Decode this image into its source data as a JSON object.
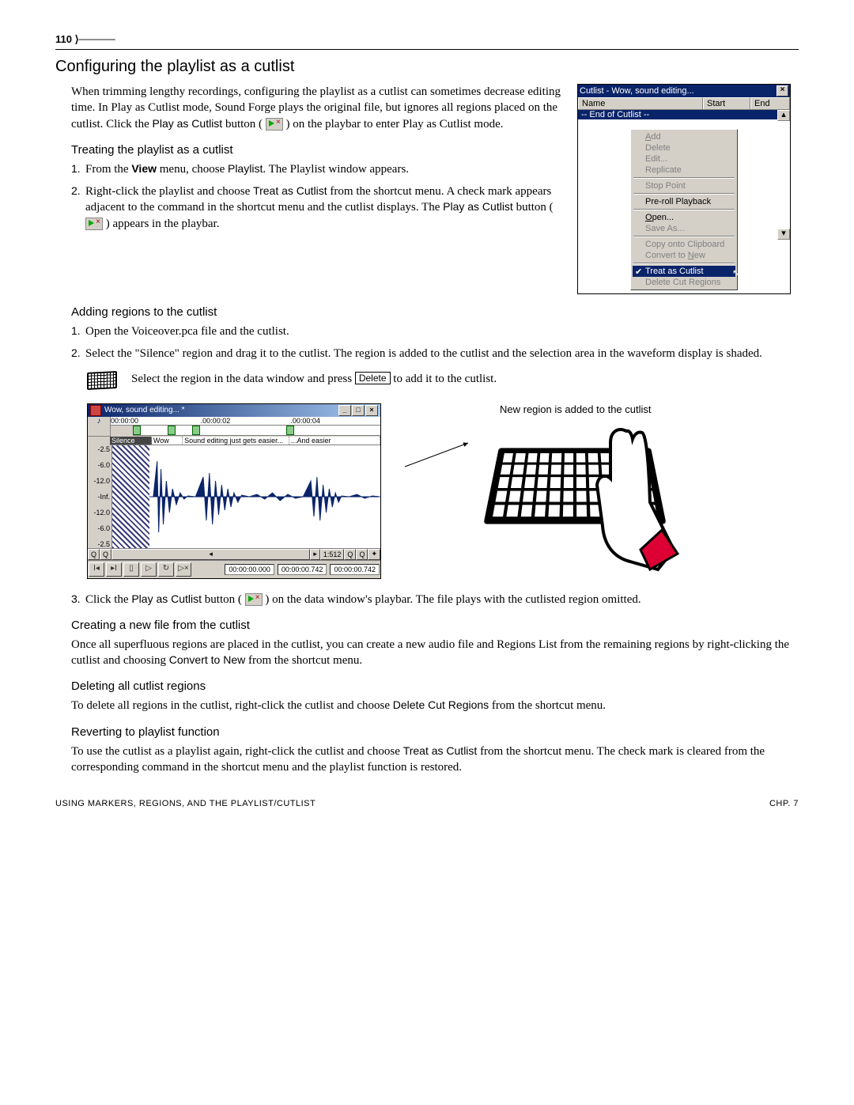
{
  "page_number": "110",
  "h1": "Configuring the playlist as a cutlist",
  "intro": {
    "text_before_btn": "When trimming lengthy recordings, configuring the playlist as a cutlist can sometimes decrease editing time. In Play as Cutlist mode, Sound Forge plays the original file, but ignores all regions placed on the cutlist. Click the ",
    "btn_label": "Play as Cutlist",
    "text_mid": " button ( ",
    "text_after": " ) on the playbar to enter Play as Cutlist mode."
  },
  "treating": {
    "heading": "Treating the playlist as a cutlist",
    "step1_a": "From the ",
    "step1_view": "View",
    "step1_b": " menu, choose ",
    "step1_playlist": "Playlist",
    "step1_c": ". The Playlist window appears.",
    "step2_a": "Right-click the playlist and choose ",
    "step2_cmd": "Treat as Cutlist",
    "step2_b": " from the shortcut menu. A check mark appears adjacent to the command in the shortcut menu and the cutlist displays. The ",
    "step2_play": "Play as Cutlist",
    "step2_c": " button ( ",
    "step2_d": " ) appears in the playbar."
  },
  "adding": {
    "heading": "Adding regions to the cutlist",
    "step1": "Open the Voiceover.pca file and the cutlist.",
    "step2": "Select the \"Silence\" region and drag it to the cutlist. The region is added to the cutlist and the selection area in the waveform display is shaded.",
    "tip_a": "Select the region in the data window and press ",
    "tip_key": "Delete",
    "tip_b": " to add it to the cutlist.",
    "step3_a": "Click the ",
    "step3_btn": "Play as Cutlist",
    "step3_b": " button ( ",
    "step3_c": " ) on the data window's playbar. The file plays with the cutlisted region omitted."
  },
  "creating": {
    "heading": "Creating a new file from the cutlist",
    "body_a": "Once all superfluous regions are placed in the cutlist, you can create a new audio file and Regions List from the remaining regions by right-clicking the cutlist and choosing ",
    "cmd": "Convert to New",
    "body_b": " from the shortcut menu."
  },
  "deleting": {
    "heading": "Deleting all cutlist regions",
    "body_a": "To delete all regions in the cutlist, right-click the cutlist and choose ",
    "cmd": "Delete Cut Regions",
    "body_b": " from the shortcut menu."
  },
  "reverting": {
    "heading": "Reverting to playlist function",
    "body_a": "To use the cutlist as a playlist again, right-click the cutlist and choose ",
    "cmd": "Treat as Cutlist",
    "body_b": " from the shortcut menu. The check mark is cleared from the corresponding command in the shortcut menu and the playlist function is restored."
  },
  "cutlist": {
    "title": "Cutlist - Wow, sound editing...",
    "cols": {
      "name": "Name",
      "start": "Start",
      "end": "End"
    },
    "endrow": "-- End of Cutlist --",
    "menu": {
      "add": "Add",
      "delete": "Delete",
      "edit": "Edit...",
      "replicate": "Replicate",
      "stop": "Stop Point",
      "preroll": "Pre-roll Playback",
      "open": "Open...",
      "saveas": "Save As...",
      "copy": "Copy onto Clipboard",
      "convert": "Convert to New",
      "treat": "Treat as Cutlist",
      "delregions": "Delete Cut Regions"
    }
  },
  "wave": {
    "title": "Wow, sound editing... *",
    "t0": "00:00:00",
    "t2": ".00:00:02",
    "t4": ".00:00:04",
    "regions": {
      "silence": "Silence",
      "wow": "Wow",
      "easier": "Sound editing just gets easier...",
      "and": "...And easier"
    },
    "scale": [
      "-2.5",
      "-6.0",
      "-12.0",
      "-Inf.",
      "-12.0",
      "-6.0",
      "-2.5"
    ],
    "zoom": "1:512",
    "time1": "00:00:00.000",
    "time2": "00:00:00.742",
    "time3": "00:00:00.742"
  },
  "caption": "New region is added to the cutlist",
  "footer": {
    "left": "USING MARKERS, REGIONS, AND THE PLAYLIST/CUTLIST",
    "right": "CHP. 7"
  }
}
